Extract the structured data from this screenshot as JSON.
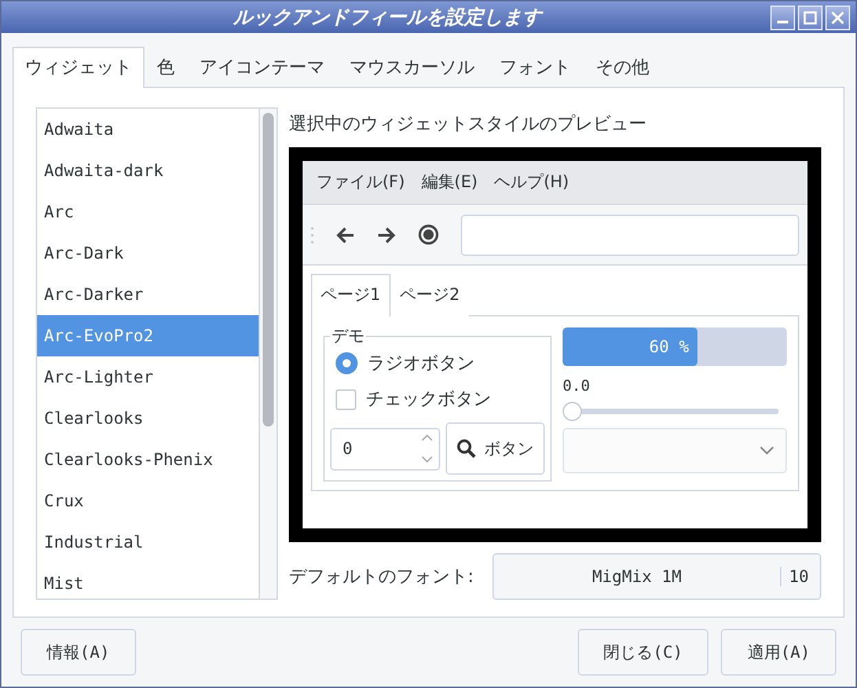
{
  "window": {
    "title": "ルックアンドフィールを設定します"
  },
  "tabs": [
    {
      "label": "ウィジェット",
      "selected": true
    },
    {
      "label": "色",
      "selected": false
    },
    {
      "label": "アイコンテーマ",
      "selected": false
    },
    {
      "label": "マウスカーソル",
      "selected": false
    },
    {
      "label": "フォント",
      "selected": false
    },
    {
      "label": "その他",
      "selected": false
    }
  ],
  "themes": [
    {
      "name": "Adwaita",
      "selected": false
    },
    {
      "name": "Adwaita-dark",
      "selected": false
    },
    {
      "name": "Arc",
      "selected": false
    },
    {
      "name": "Arc-Dark",
      "selected": false
    },
    {
      "name": "Arc-Darker",
      "selected": false
    },
    {
      "name": "Arc-EvoPro2",
      "selected": true
    },
    {
      "name": "Arc-Lighter",
      "selected": false
    },
    {
      "name": "Clearlooks",
      "selected": false
    },
    {
      "name": "Clearlooks-Phenix",
      "selected": false
    },
    {
      "name": "Crux",
      "selected": false
    },
    {
      "name": "Industrial",
      "selected": false
    },
    {
      "name": "Mist",
      "selected": false
    }
  ],
  "preview": {
    "label": "選択中のウィジェットスタイルのプレビュー",
    "menu": [
      "ファイル(F)",
      "編集(E)",
      "ヘルプ(H)"
    ],
    "tabs": [
      {
        "label": "ページ1",
        "selected": true
      },
      {
        "label": "ページ2",
        "selected": false
      }
    ],
    "group": "デモ",
    "radio": {
      "label": "ラジオボタン",
      "selected": true
    },
    "check": {
      "label": "チェックボタン",
      "checked": false
    },
    "spin": {
      "value": "0"
    },
    "button": "ボタン",
    "progress": {
      "level": 0.6,
      "text": "60 %"
    },
    "slider": {
      "reading": "0.0",
      "level": 0
    }
  },
  "font": {
    "label": "デフォルトのフォント:",
    "name": "MigMix 1M",
    "size": "10"
  },
  "buttons": {
    "about": "情報(A)",
    "close": "閉じる(C)",
    "apply": "適用(A)"
  }
}
